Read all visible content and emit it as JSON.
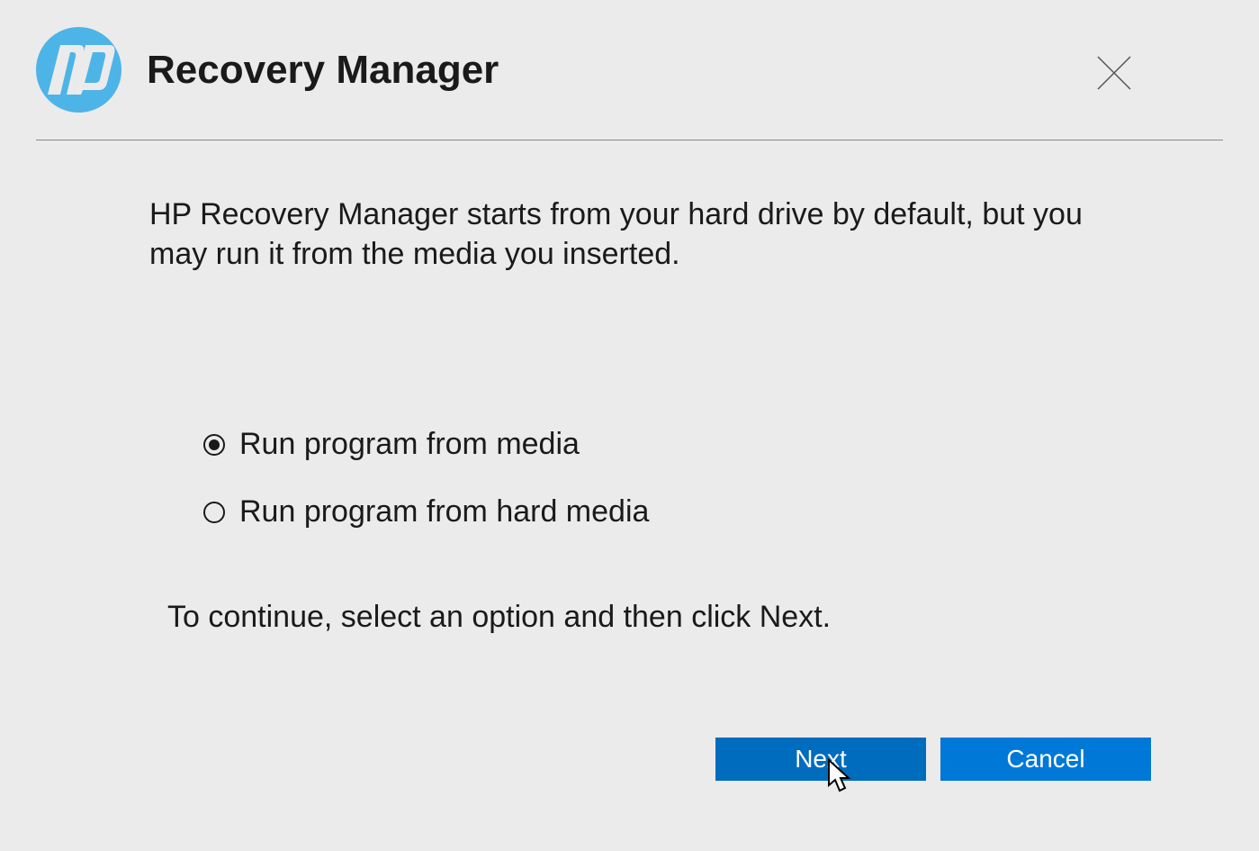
{
  "header": {
    "title": "Recovery Manager"
  },
  "content": {
    "description": "HP Recovery Manager starts from your hard drive by default, but you may run it from the media you inserted.",
    "options": [
      {
        "label": "Run program from media",
        "selected": true
      },
      {
        "label": "Run program from hard media",
        "selected": false
      }
    ],
    "instruction": "To continue, select an option and then click Next."
  },
  "footer": {
    "next_label": "Next",
    "cancel_label": "Cancel"
  }
}
